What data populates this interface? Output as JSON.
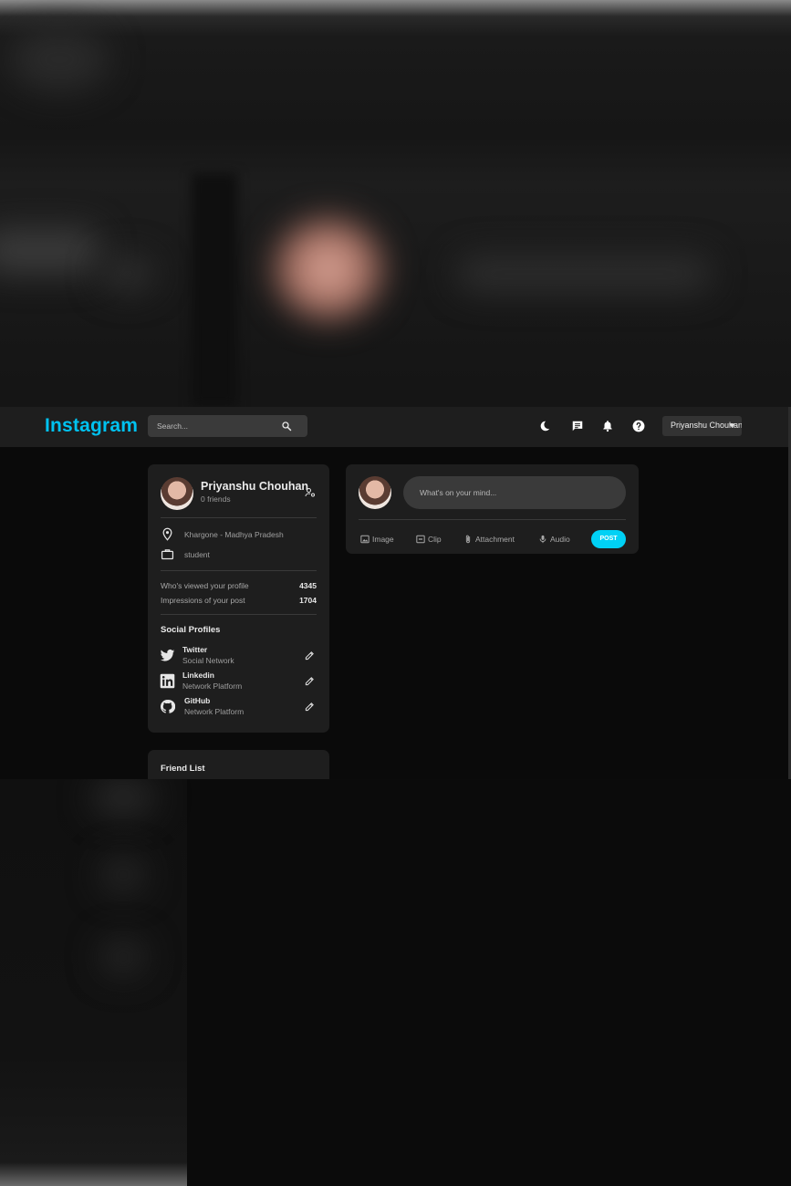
{
  "header": {
    "logo": "Instagram",
    "search_placeholder": "Search...",
    "user_menu_value": "Priyanshu Chouhan"
  },
  "profile": {
    "name": "Priyanshu Chouhan",
    "friends": "0 friends",
    "location": "Khargone - Madhya Pradesh",
    "occupation": "student",
    "stats": [
      {
        "label": "Who's viewed your profile",
        "value": "4345"
      },
      {
        "label": "Impressions of your post",
        "value": "1704"
      }
    ],
    "social_title": "Social Profiles",
    "socials": [
      {
        "name": "Twitter",
        "sub": "Social Network",
        "icon": "twitter-icon"
      },
      {
        "name": "Linkedin",
        "sub": "Network Platform",
        "icon": "linkedin-icon"
      },
      {
        "name": "GitHub",
        "sub": "Network Platform",
        "icon": "github-icon"
      }
    ]
  },
  "friend_list": {
    "title": "Friend List"
  },
  "post": {
    "placeholder": "What's on your mind...",
    "actions": [
      "Image",
      "Clip",
      "Attachment",
      "Audio"
    ],
    "submit": "POST"
  },
  "colors": {
    "accent": "#00c2f0",
    "post_button": "#00d1f5",
    "card": "#1e1e1e",
    "navbar": "#1e1e1e",
    "background": "#0a0a0a"
  }
}
